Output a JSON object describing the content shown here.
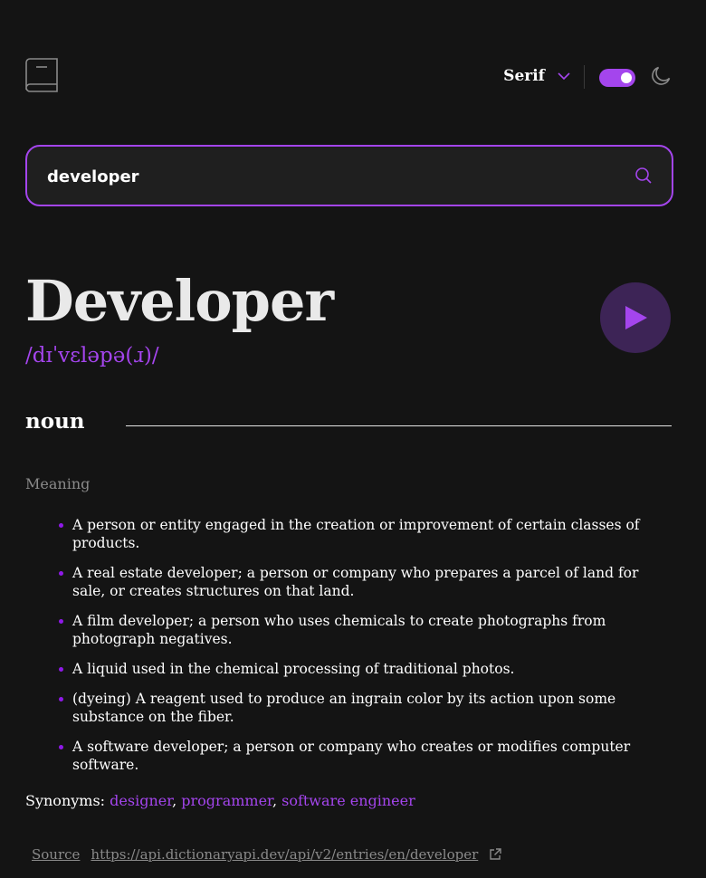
{
  "header": {
    "logo_icon": "book-icon",
    "font_label": "Serif",
    "font_chevron_icon": "chevron-down-icon",
    "theme_toggle_state": "on",
    "theme_icon": "moon-icon"
  },
  "search": {
    "value": "developer",
    "icon": "search-icon"
  },
  "entry": {
    "word": "Developer",
    "phonetic": "/dɪˈvɛləpə(ɹ)/",
    "play_icon": "play-icon",
    "part_of_speech": "noun",
    "meaning_heading": "Meaning",
    "definitions": [
      "A person or entity engaged in the creation or improvement of certain classes of products.",
      "A real estate developer; a person or company who prepares a parcel of land for sale, or creates structures on that land.",
      "A film developer; a person who uses chemicals to create photographs from photograph negatives.",
      "A liquid used in the chemical processing of traditional photos.",
      "(dyeing) A reagent used to produce an ingrain color by its action upon some substance on the fiber.",
      "A software developer; a person or company who creates or modifies computer software."
    ],
    "synonyms_label": "Synonyms:",
    "synonyms": [
      "designer",
      "programmer",
      "software engineer"
    ]
  },
  "source": {
    "label": "Source",
    "url": "https://api.dictionaryapi.dev/api/v2/entries/en/developer",
    "link_icon": "external-link-icon"
  },
  "colors": {
    "background": "#141414",
    "accent": "#a445ed",
    "muted": "#8a8a8a"
  }
}
